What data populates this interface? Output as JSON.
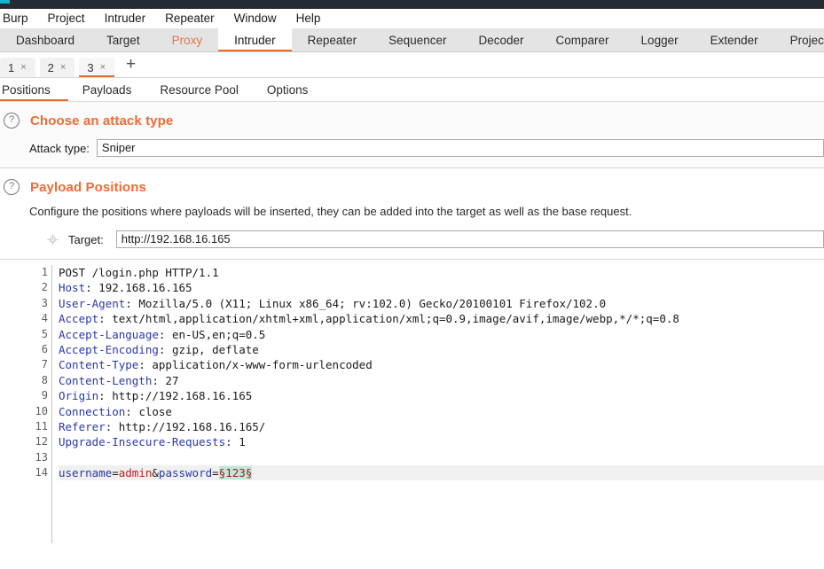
{
  "titlebar": {
    "accent_color": "#14b4cc",
    "bg_color": "#252b33"
  },
  "menubar": {
    "items": [
      {
        "label": "Burp"
      },
      {
        "label": "Project"
      },
      {
        "label": "Intruder"
      },
      {
        "label": "Repeater"
      },
      {
        "label": "Window"
      },
      {
        "label": "Help"
      }
    ]
  },
  "main_tabs": {
    "active": "Intruder",
    "accent_color": "#ea6b29",
    "items": [
      {
        "label": "Dashboard",
        "state": "normal"
      },
      {
        "label": "Target",
        "state": "normal"
      },
      {
        "label": "Proxy",
        "state": "highlight"
      },
      {
        "label": "Intruder",
        "state": "active"
      },
      {
        "label": "Repeater",
        "state": "normal"
      },
      {
        "label": "Sequencer",
        "state": "normal"
      },
      {
        "label": "Decoder",
        "state": "normal"
      },
      {
        "label": "Comparer",
        "state": "normal"
      },
      {
        "label": "Logger",
        "state": "normal"
      },
      {
        "label": "Extender",
        "state": "normal"
      },
      {
        "label": "Project options",
        "state": "normal"
      }
    ]
  },
  "attack_tabs": {
    "active": "3",
    "close_glyph": "×",
    "add_glyph": "+",
    "items": [
      {
        "label": "1",
        "state": "normal"
      },
      {
        "label": "2",
        "state": "normal"
      },
      {
        "label": "3",
        "state": "active"
      }
    ]
  },
  "sub_tabs": {
    "active": "Positions",
    "items": [
      {
        "label": "Positions",
        "state": "active"
      },
      {
        "label": "Payloads",
        "state": "normal"
      },
      {
        "label": "Resource Pool",
        "state": "normal"
      },
      {
        "label": "Options",
        "state": "normal"
      }
    ]
  },
  "attack_type_section": {
    "help_glyph": "?",
    "title": "Choose an attack type",
    "field_label": "Attack type:",
    "field_value": "Sniper"
  },
  "payload_positions_section": {
    "help_glyph": "?",
    "title": "Payload Positions",
    "description": "Configure the positions where payloads will be inserted, they can be added into the target as well as the base request.",
    "target_label": "Target:",
    "target_value": "http://192.168.16.165"
  },
  "request_editor": {
    "line_numbers": [
      "1",
      "2",
      "3",
      "4",
      "5",
      "6",
      "7",
      "8",
      "9",
      "10",
      "11",
      "12",
      "13",
      "14"
    ],
    "lines": [
      {
        "n": 1,
        "type": "request-line",
        "text": "POST /login.php HTTP/1.1"
      },
      {
        "n": 2,
        "type": "header",
        "name": "Host",
        "value": " 192.168.16.165"
      },
      {
        "n": 3,
        "type": "header",
        "name": "User-Agent",
        "value": " Mozilla/5.0 (X11; Linux x86_64; rv:102.0) Gecko/20100101 Firefox/102.0"
      },
      {
        "n": 4,
        "type": "header",
        "name": "Accept",
        "value": " text/html,application/xhtml+xml,application/xml;q=0.9,image/avif,image/webp,*/*;q=0.8"
      },
      {
        "n": 5,
        "type": "header",
        "name": "Accept-Language",
        "value": " en-US,en;q=0.5"
      },
      {
        "n": 6,
        "type": "header",
        "name": "Accept-Encoding",
        "value": " gzip, deflate"
      },
      {
        "n": 7,
        "type": "header",
        "name": "Content-Type",
        "value": " application/x-www-form-urlencoded"
      },
      {
        "n": 8,
        "type": "header",
        "name": "Content-Length",
        "value": " 27"
      },
      {
        "n": 9,
        "type": "header",
        "name": "Origin",
        "value": " http://192.168.16.165"
      },
      {
        "n": 10,
        "type": "header",
        "name": "Connection",
        "value": " close"
      },
      {
        "n": 11,
        "type": "header",
        "name": "Referer",
        "value": " http://192.168.16.165/"
      },
      {
        "n": 12,
        "type": "header",
        "name": "Upgrade-Insecure-Requests",
        "value": " 1"
      },
      {
        "n": 13,
        "type": "blank",
        "text": ""
      },
      {
        "n": 14,
        "type": "body",
        "params": [
          {
            "key": "username",
            "eq": "=",
            "value": "admin",
            "marked": false
          },
          {
            "sep": "&"
          },
          {
            "key": "password",
            "eq": "=",
            "value": "§123§",
            "marked": true
          }
        ]
      }
    ],
    "payload_marker": "§123§",
    "marker_bg_color": "#bfe8d8",
    "marker_text_color": "#a01c1c",
    "header_name_color": "#2b38a8"
  }
}
